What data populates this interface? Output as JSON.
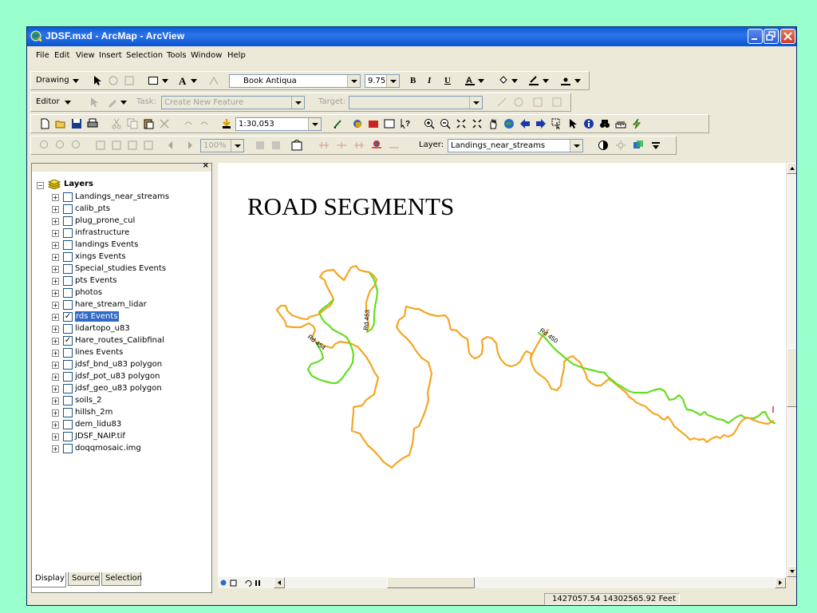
{
  "window": {
    "title": "JDSF.mxd - ArcMap - ArcView"
  },
  "menus": [
    "File",
    "Edit",
    "View",
    "Insert",
    "Selection",
    "Tools",
    "Window",
    "Help"
  ],
  "drawing_toolbar": {
    "drawing_label": "Drawing",
    "font_name": "Book Antiqua",
    "font_size": "9.75",
    "bold": "B",
    "italic": "I",
    "underline": "U"
  },
  "editor_toolbar": {
    "editor_label": "Editor",
    "task_label": "Task:",
    "task_value": "Create New Feature",
    "target_label": "Target:",
    "target_value": ""
  },
  "standard_toolbar": {
    "scale": "1:30,053"
  },
  "tools_toolbar": {
    "zoom_level": "100%",
    "layer_label": "Layer:",
    "layer_value": "Landings_near_streams"
  },
  "toc": {
    "root_label": "Layers",
    "layers": [
      {
        "name": "Landings_near_streams",
        "checked": false,
        "selected": false
      },
      {
        "name": "calib_pts",
        "checked": false,
        "selected": false
      },
      {
        "name": "plug_prone_cul",
        "checked": false,
        "selected": false
      },
      {
        "name": "infrastructure",
        "checked": false,
        "selected": false
      },
      {
        "name": "landings Events",
        "checked": false,
        "selected": false
      },
      {
        "name": "xings Events",
        "checked": false,
        "selected": false
      },
      {
        "name": "Special_studies Events",
        "checked": false,
        "selected": false
      },
      {
        "name": "pts Events",
        "checked": false,
        "selected": false
      },
      {
        "name": "photos",
        "checked": false,
        "selected": false
      },
      {
        "name": "hare_stream_lidar",
        "checked": false,
        "selected": false
      },
      {
        "name": "rds Events",
        "checked": true,
        "selected": true
      },
      {
        "name": "lidartopo_u83",
        "checked": false,
        "selected": false
      },
      {
        "name": "Hare_routes_Calibfinal",
        "checked": true,
        "selected": false
      },
      {
        "name": "lines Events",
        "checked": false,
        "selected": false
      },
      {
        "name": "jdsf_bnd_u83 polygon",
        "checked": false,
        "selected": false
      },
      {
        "name": "jdsf_pot_u83 polygon",
        "checked": false,
        "selected": false
      },
      {
        "name": "jdsf_geo_u83 polygon",
        "checked": false,
        "selected": false
      },
      {
        "name": "soils_2",
        "checked": false,
        "selected": false
      },
      {
        "name": "hillsh_2m",
        "checked": false,
        "selected": false
      },
      {
        "name": "dem_lidu83",
        "checked": false,
        "selected": false
      },
      {
        "name": "JDSF_NAIP.tif",
        "checked": false,
        "selected": false
      },
      {
        "name": "doqqmosaic.img",
        "checked": false,
        "selected": false
      }
    ],
    "tabs": [
      "Display",
      "Source",
      "Selection"
    ]
  },
  "map": {
    "title": "ROAD SEGMENTS",
    "road_labels": [
      "Rd 453",
      "Rd 454",
      "Rd 450"
    ],
    "colors": {
      "orange": "#f5a623",
      "green": "#66dd22",
      "background": "#ffffff"
    }
  },
  "status": {
    "coordinates": "1427057.54  14302565.92 Feet"
  },
  "colors": {
    "desktop": "#99ffcc",
    "titlebar": "#0a5bd8",
    "chrome": "#ece9d8",
    "selection": "#316ac5"
  }
}
